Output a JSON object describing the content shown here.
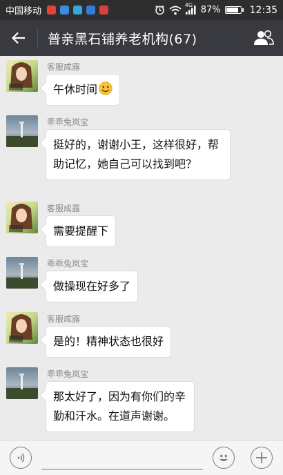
{
  "status_bar": {
    "carrier": "中国移动",
    "network": "4G",
    "battery": "87%",
    "battery_level": 0.87,
    "time": "12:35"
  },
  "header": {
    "title": "普亲黑石铺养老机构(67)"
  },
  "messages": [
    {
      "sender": "客服成露",
      "avatar": "girl-photo",
      "text": "午休时间",
      "emoji": "smiley"
    },
    {
      "sender": "乖乖兔岚宝",
      "avatar": "landscape-photo",
      "text": "挺好的，谢谢小王，这样很好，帮助记忆，她自己可以找到吧？"
    },
    {
      "sender": "客服成露",
      "avatar": "girl-photo",
      "text": "需要提醒下"
    },
    {
      "sender": "乖乖兔岚宝",
      "avatar": "landscape-photo",
      "text": "做操现在好多了"
    },
    {
      "sender": "客服成露",
      "avatar": "girl-photo",
      "text": "是的！精神状态也很好"
    },
    {
      "sender": "乖乖兔岚宝",
      "avatar": "landscape-photo",
      "text": "那太好了，因为有你们的辛勤和汗水。在道声谢谢。"
    }
  ],
  "colors": {
    "status_bar": "#2e2e2e",
    "title_bar": "#393a3f",
    "chat_bg": "#ebebeb",
    "input_underline": "#1aad19"
  },
  "icons": {
    "back": "arrow-left-icon",
    "group": "group-members-icon",
    "voice": "voice-icon",
    "emoji": "emoji-icon",
    "more": "plus-icon"
  }
}
